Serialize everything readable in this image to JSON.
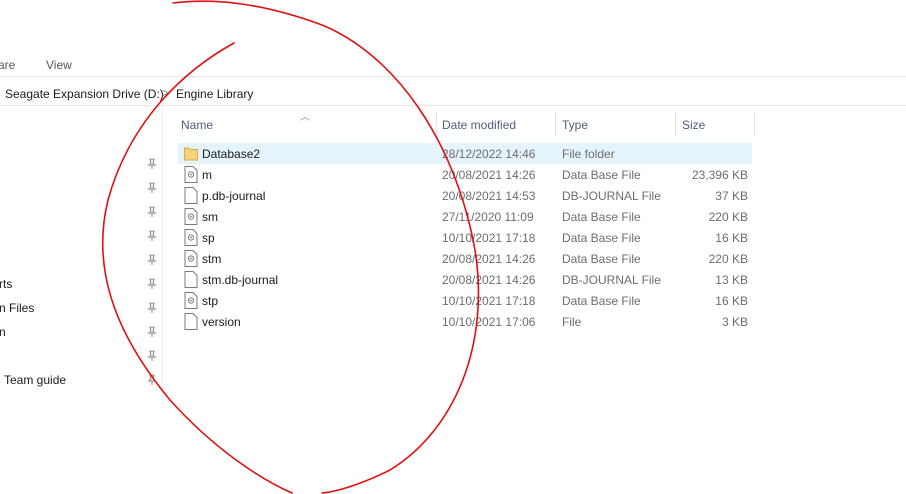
{
  "ribbon": {
    "tabs": [
      "are",
      "View"
    ]
  },
  "address": {
    "crumbs": [
      "Seagate Expansion Drive (D:)",
      "Engine Library"
    ],
    "separator": ">"
  },
  "nav": {
    "items": [
      "rts",
      "n Files",
      "n",
      "Team guide"
    ]
  },
  "columns": {
    "name": "Name",
    "date": "Date modified",
    "type": "Type",
    "size": "Size"
  },
  "files": [
    {
      "name": "Database2",
      "date": "28/12/2022 14:46",
      "type": "File folder",
      "size": "",
      "icon": "folder-icon"
    },
    {
      "name": "m",
      "date": "20/08/2021 14:26",
      "type": "Data Base File",
      "size": "23,396 KB",
      "icon": "database-file-icon"
    },
    {
      "name": "p.db-journal",
      "date": "20/08/2021 14:53",
      "type": "DB-JOURNAL File",
      "size": "37 KB",
      "icon": "blank-file-icon"
    },
    {
      "name": "sm",
      "date": "27/11/2020 11:09",
      "type": "Data Base File",
      "size": "220 KB",
      "icon": "database-file-icon"
    },
    {
      "name": "sp",
      "date": "10/10/2021 17:18",
      "type": "Data Base File",
      "size": "16 KB",
      "icon": "database-file-icon"
    },
    {
      "name": "stm",
      "date": "20/08/2021 14:26",
      "type": "Data Base File",
      "size": "220 KB",
      "icon": "database-file-icon"
    },
    {
      "name": "stm.db-journal",
      "date": "20/08/2021 14:26",
      "type": "DB-JOURNAL File",
      "size": "13 KB",
      "icon": "blank-file-icon"
    },
    {
      "name": "stp",
      "date": "10/10/2021 17:18",
      "type": "Data Base File",
      "size": "16 KB",
      "icon": "database-file-icon"
    },
    {
      "name": "version",
      "date": "10/10/2021 17:06",
      "type": "File",
      "size": "3 KB",
      "icon": "blank-file-icon"
    }
  ],
  "colors": {
    "selection": "#e5f3fb",
    "header_text": "#4c607a",
    "annotation": "#e01010",
    "folder": "#f4d27a"
  }
}
